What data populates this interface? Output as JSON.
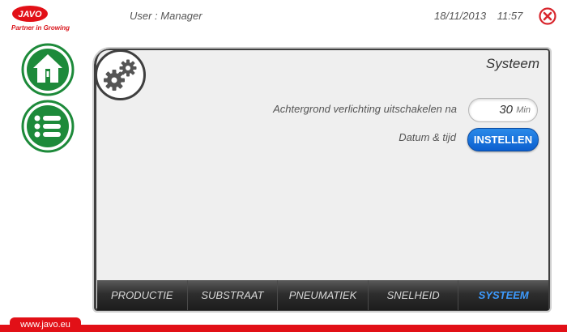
{
  "brand": {
    "name": "JAVO",
    "slogan": "Partner in Growing",
    "url": "www.javo.eu",
    "color": "#e21017"
  },
  "header": {
    "user": "User : Manager",
    "date": "18/11/2013",
    "time": "11:57",
    "close_icon": "close-circle-icon"
  },
  "sidebar": {
    "home_icon": "home-icon",
    "menu_icon": "list-menu-icon",
    "accent": "#1d8a3a"
  },
  "panel": {
    "title": "Systeem",
    "icon": "gears-icon",
    "backlight_label": "Achtergrond verlichting uitschakelen na",
    "backlight_value": "30",
    "backlight_unit": "Min",
    "datetime_label": "Datum & tijd",
    "set_button": "INSTELLEN",
    "button_color": "#1a73e0"
  },
  "tabs": [
    {
      "label": "PRODUCTIE",
      "active": false
    },
    {
      "label": "SUBSTRAAT",
      "active": false
    },
    {
      "label": "PNEUMATIEK",
      "active": false
    },
    {
      "label": "SNELHEID",
      "active": false
    },
    {
      "label": "SYSTEEM",
      "active": true
    }
  ]
}
